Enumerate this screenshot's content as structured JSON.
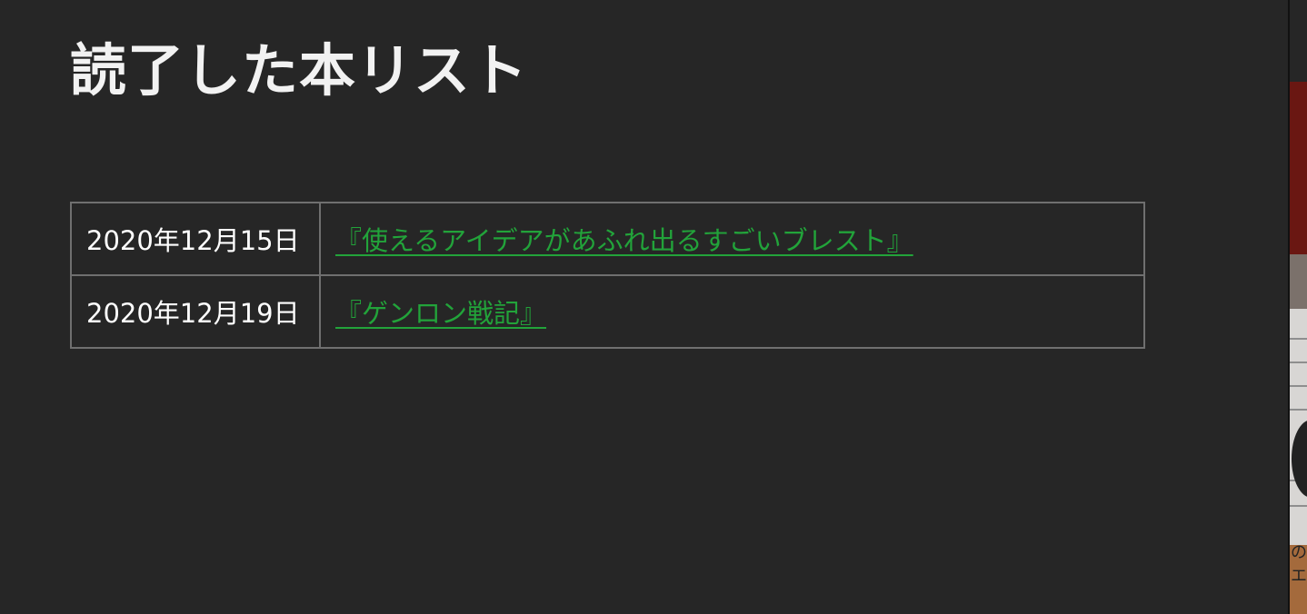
{
  "page": {
    "title": "読了した本リスト"
  },
  "books": [
    {
      "date": "2020年12月15日",
      "title": "『使えるアイデアがあふれ出るすごいブレスト』"
    },
    {
      "date": "2020年12月19日",
      "title": "『ゲンロン戦記』"
    }
  ],
  "side_panel": {
    "partial_text": "のエ"
  },
  "colors": {
    "background": "#262626",
    "title_text": "#f2f2f2",
    "link": "#22a33a",
    "table_border": "#6f6f6f"
  }
}
